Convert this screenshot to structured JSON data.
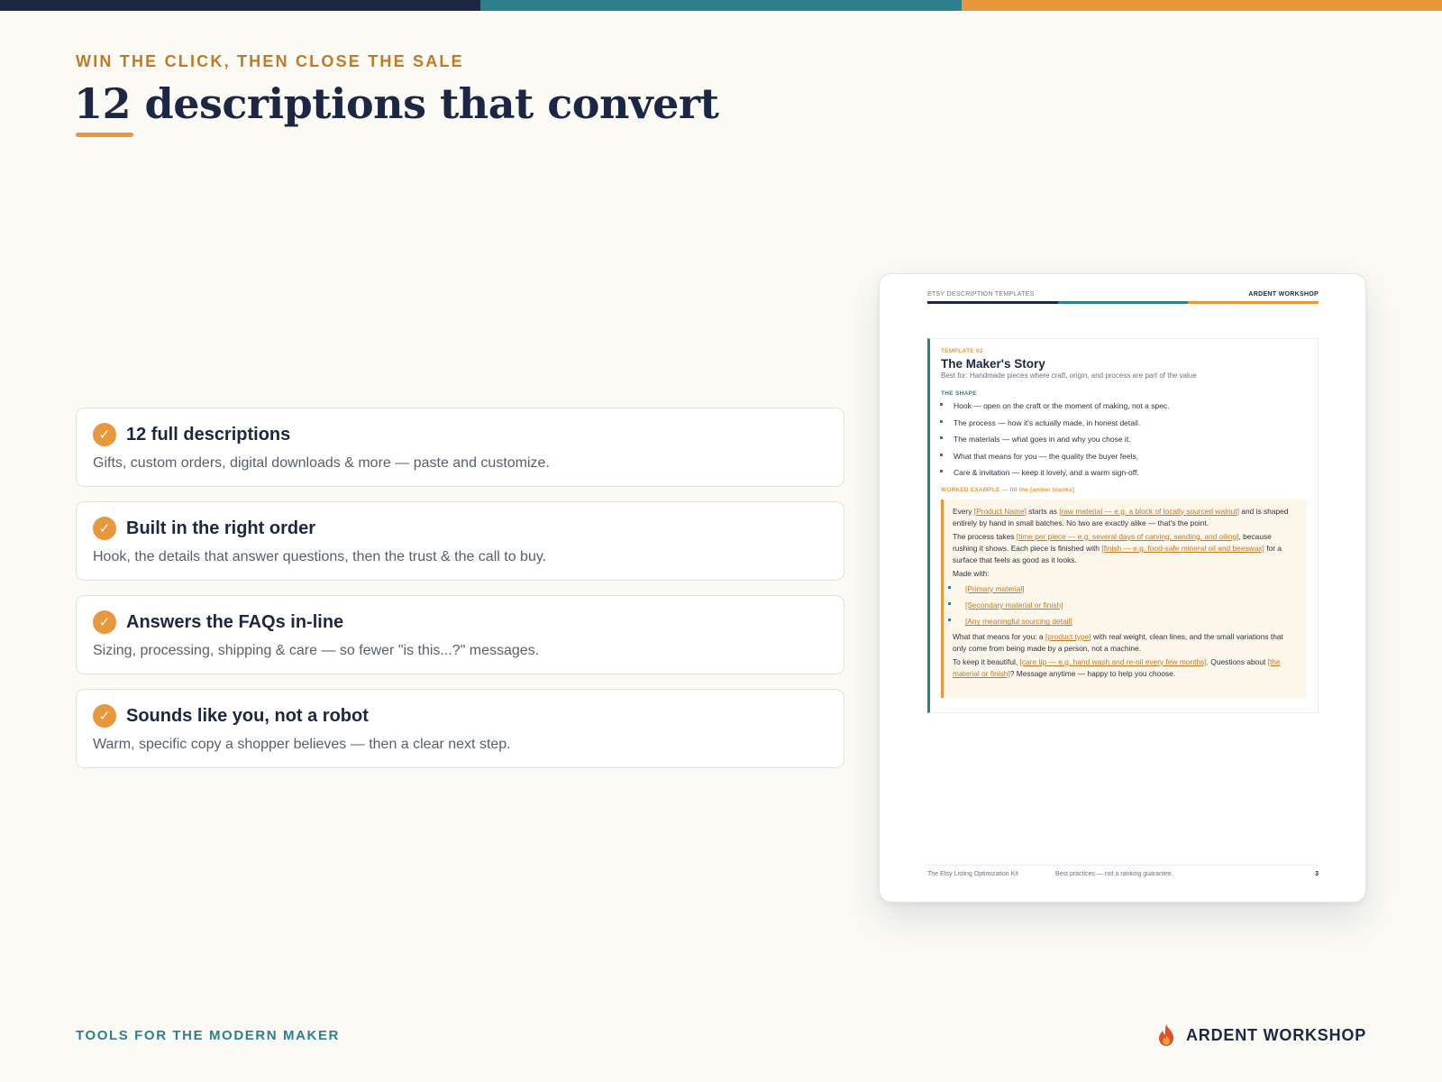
{
  "colors": {
    "navy": "#1c2744",
    "teal": "#2e7f8c",
    "amber": "#e8973c",
    "background": "#fbfaf5"
  },
  "header": {
    "eyebrow": "WIN THE CLICK, THEN CLOSE THE SALE",
    "title": "12 descriptions that convert"
  },
  "features": [
    {
      "title": "12 full descriptions",
      "description": "Gifts, custom orders, digital downloads & more — paste and customize."
    },
    {
      "title": "Built in the right order",
      "description": "Hook, the details that answer questions, then the trust & the call to buy."
    },
    {
      "title": "Answers the FAQs in-line",
      "description": "Sizing, processing, shipping & care — so fewer \"is this...?\" messages."
    },
    {
      "title": "Sounds like you, not a robot",
      "description": "Warm, specific copy a shopper believes — then a clear next step."
    }
  ],
  "check_icon": "check-circle-icon",
  "check_glyph": "✓",
  "doc_preview": {
    "header_left": "ETSY DESCRIPTION TEMPLATES",
    "header_right": "ARDENT WORKSHOP",
    "template_number": "TEMPLATE 02",
    "template_title": "The Maker's Story",
    "best_for": "Best for: Handmade pieces where craft, origin, and process are part of the value",
    "shape_label": "THE SHAPE",
    "shape_items": [
      "Hook — open on the craft or the moment of making, not a spec.",
      "The process — how it's actually made, in honest detail.",
      "The materials — what goes in and why you chose it.",
      "What that means for you — the quality the buyer feels.",
      "Care & invitation — keep it lovely, and a warm sign-off."
    ],
    "worked_label": "WORKED EXAMPLE — fill the [amber blanks]",
    "example": {
      "p1": {
        "t1": "Every ",
        "b1": "[Product Name]",
        "t2": " starts as ",
        "b2": "[raw material — e.g. a block of locally sourced walnut]",
        "t3": " and is shaped entirely by hand in small batches. No two are exactly alike — that's the point."
      },
      "p2": {
        "t1": "The process takes ",
        "b1": "[time per piece — e.g. several days of carving, sanding, and oiling]",
        "t2": ", because rushing it shows. Each piece is finished with ",
        "b2": "[finish — e.g. food-safe mineral oil and beeswax]",
        "t3": " for a surface that feels as good as it looks."
      },
      "made_with": "Made with:",
      "made_items": [
        "[Primary material]",
        "[Secondary material or finish]",
        "[Any meaningful sourcing detail]"
      ],
      "p3": {
        "t1": "What that means for you: a ",
        "b1": "[product type]",
        "t2": " with real weight, clean lines, and the small variations that only come from being made by a person, not a machine."
      },
      "p4": {
        "t1": "To keep it beautiful, ",
        "b1": "[care tip — e.g. hand wash and re-oil every few months]",
        "t2": ". Questions about ",
        "b2": "[the material or finish]",
        "t3": "? Message anytime — happy to help you choose."
      }
    },
    "footer_left": "The Etsy Listing Optimization Kit",
    "footer_mid": "Best practices — not a ranking guarantee.",
    "page_number": "3"
  },
  "footer": {
    "tagline": "TOOLS FOR THE MODERN MAKER",
    "brand_name": "ARDENT WORKSHOP",
    "brand_icon": "flame-icon"
  }
}
